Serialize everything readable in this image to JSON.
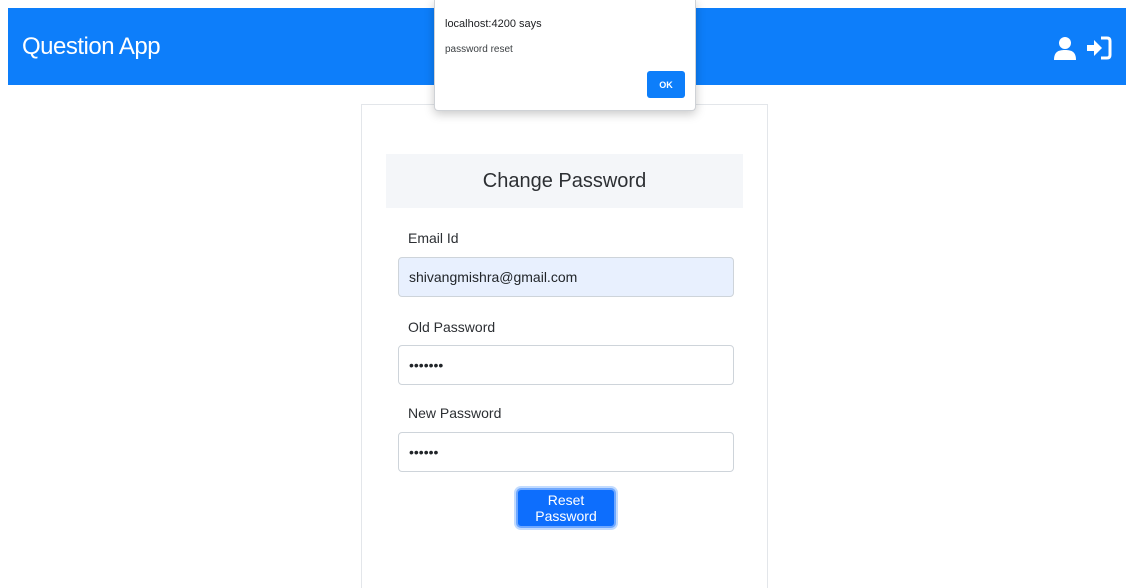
{
  "navbar": {
    "brand": "Question App",
    "icons": [
      "user-icon",
      "sign-in-icon"
    ],
    "color": "#0d7efa"
  },
  "form": {
    "title": "Change Password",
    "email_label": "Email Id",
    "email_value": "shivangmishra@gmail.com",
    "old_password_label": "Old Password",
    "old_password_value": "•••••••",
    "new_password_label": "New Password",
    "new_password_value": "••••••",
    "submit_label": "Reset Password"
  },
  "alert": {
    "title": "localhost:4200 says",
    "message": "password reset",
    "ok_label": "OK"
  }
}
